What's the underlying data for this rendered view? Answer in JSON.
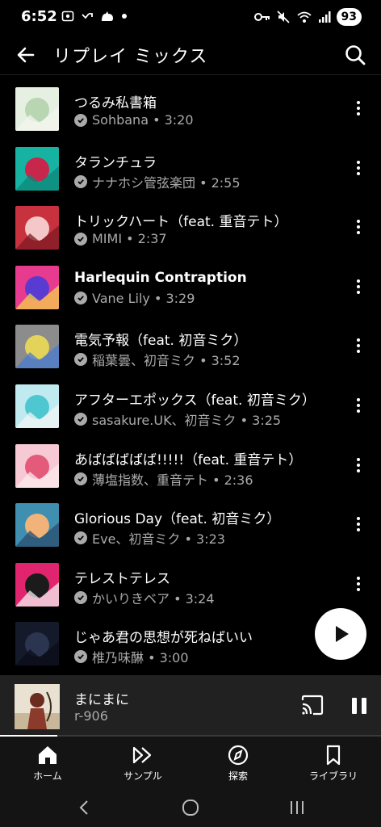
{
  "status_bar": {
    "time": "6:52",
    "battery": "93"
  },
  "header": {
    "title": "リプレイ ミックス"
  },
  "tracks": [
    {
      "title": "つるみ私書箱",
      "subtitle": "Sohbana • 3:20",
      "bold": false,
      "art_colors": [
        "#e6f0e2",
        "#b9d6b3",
        "#f3f6ee"
      ]
    },
    {
      "title": "タランチュラ",
      "subtitle": "ナナホシ管弦楽団 • 2:55",
      "bold": false,
      "art_colors": [
        "#16b3a3",
        "#c8264a",
        "#0e8578"
      ]
    },
    {
      "title": "トリックハート（feat. 重音テト）",
      "subtitle": "MIMI • 2:37",
      "bold": false,
      "art_colors": [
        "#c8323f",
        "#f4c8c8",
        "#7d1a24"
      ]
    },
    {
      "title": "Harlequin Contraption",
      "subtitle": "Vane Lily • 3:29",
      "bold": true,
      "art_colors": [
        "#e63b8f",
        "#5a3bd1",
        "#f5d24a"
      ]
    },
    {
      "title": "電気予報（feat. 初音ミク）",
      "subtitle": "稲葉曇、初音ミク • 3:52",
      "bold": false,
      "art_colors": [
        "#8c8c8c",
        "#e3d35a",
        "#4a7bd0"
      ]
    },
    {
      "title": "アフターエポックス（feat. 初音ミク）",
      "subtitle": "sasakure.UK、初音ミク • 3:25",
      "bold": false,
      "art_colors": [
        "#bfeaf0",
        "#4fc7d0",
        "#f2f6f7"
      ]
    },
    {
      "title": "あばばばばば!!!!!（feat. 重音テト）",
      "subtitle": "薄塩指数、重音テト • 2:36",
      "bold": false,
      "art_colors": [
        "#f7c9d4",
        "#e45a7a",
        "#fbe9ee"
      ]
    },
    {
      "title": "Glorious Day（feat. 初音ミク）",
      "subtitle": "Eve、初音ミク • 3:23",
      "bold": false,
      "art_colors": [
        "#3e8fb0",
        "#f2b37a",
        "#2a4c6e"
      ]
    },
    {
      "title": "テレストテレス",
      "subtitle": "かいりきベア • 3:24",
      "bold": false,
      "art_colors": [
        "#e0246e",
        "#1b1b1b",
        "#f6f0f3"
      ]
    },
    {
      "title": "じゃあ君の思想が死ねばいい",
      "subtitle": "椎乃味醂 • 3:00",
      "bold": false,
      "art_colors": [
        "#141a2a",
        "#2b3550",
        "#0b0e18"
      ]
    }
  ],
  "mini_player": {
    "title": "まにまに",
    "artist": "r-906",
    "progress": 0.15
  },
  "nav": [
    {
      "label": "ホーム",
      "icon": "home-icon"
    },
    {
      "label": "サンプル",
      "icon": "samples-icon"
    },
    {
      "label": "探索",
      "icon": "explore-icon"
    },
    {
      "label": "ライブラリ",
      "icon": "library-icon"
    }
  ]
}
